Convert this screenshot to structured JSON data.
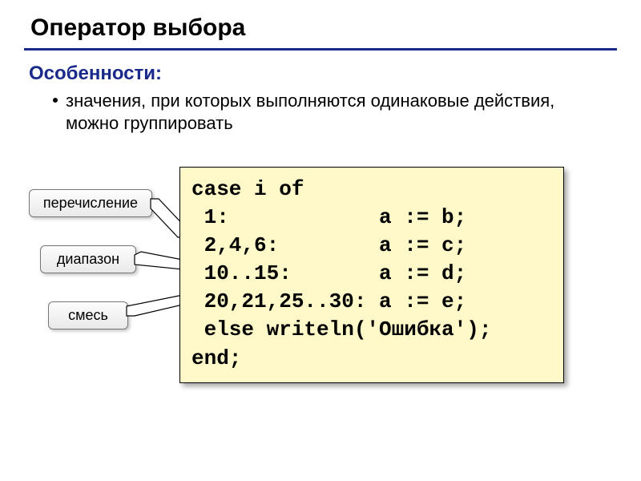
{
  "title": "Оператор выбора",
  "subheading": "Особенности:",
  "bullet": "значения, при которых выполняются одинаковые действия, можно группировать",
  "labels": {
    "enum": "перечисление",
    "range": "диапазон",
    "mix": "смесь"
  },
  "code": {
    "l1": "case i of",
    "l2": " 1:            a := b;",
    "l3": " 2,4,6:        a := c;",
    "l4": " 10..15:       a := d;",
    "l5": " 20,21,25..30: a := e;",
    "l6": " else writeln('Ошибка');",
    "l7": "end;"
  }
}
